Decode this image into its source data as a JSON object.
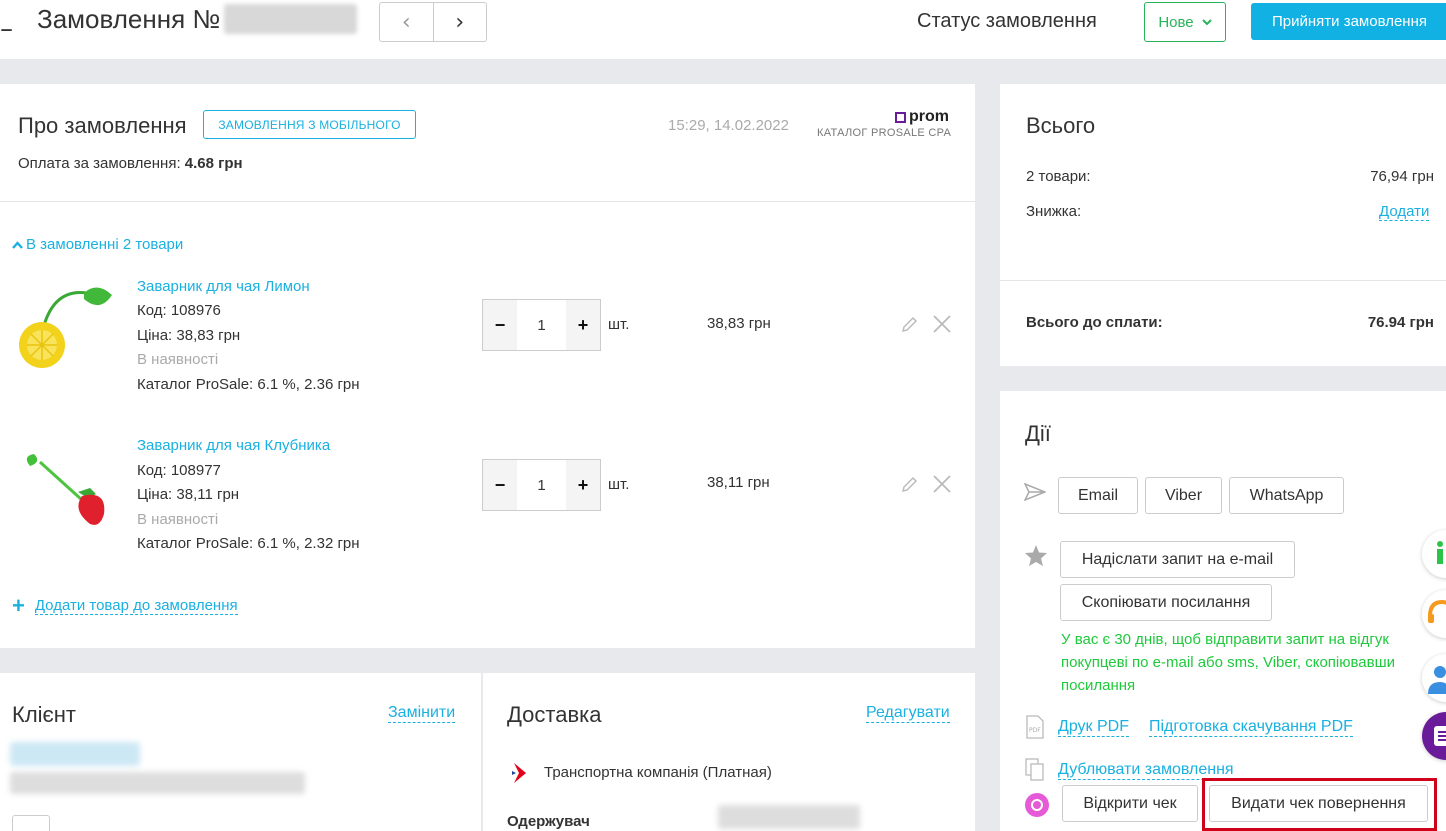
{
  "header": {
    "title": "Замовлення №",
    "status_label": "Статус замовлення",
    "status_value": "Нове",
    "accept_button": "Прийняти замовлення"
  },
  "order": {
    "title": "Про замовлення",
    "mobile_badge": "ЗАМОВЛЕННЯ З МОБІЛЬНОГО",
    "datetime": "15:29, 14.02.2022",
    "logo_text": "prom",
    "catalog_label": "КАТАЛОГ PROSALE CPA",
    "payment_label": "Оплата за замовлення:",
    "payment_value": "4.68 грн",
    "items_toggle": "В замовленні 2 товари",
    "items": [
      {
        "name": "Заварник для чая Лимон",
        "code": "Код: 108976",
        "price": "Ціна: 38,83 грн",
        "stock": "В наявності",
        "catalog": "Каталог ProSale: 6.1 %, 2.36 грн",
        "qty": "1",
        "unit": "шт.",
        "total": "38,83 грн"
      },
      {
        "name": "Заварник для чая Клубника",
        "code": "Код: 108977",
        "price": "Ціна: 38,11 грн",
        "stock": "В наявності",
        "catalog": "Каталог ProSale: 6.1 %, 2.32 грн",
        "qty": "1",
        "unit": "шт.",
        "total": "38,11 грн"
      }
    ],
    "add_product": "Додати товар до замовлення"
  },
  "totals": {
    "title": "Всього",
    "items_label": "2 товари:",
    "items_value": "76,94 грн",
    "discount_label": "Знижка:",
    "discount_link": "Додати",
    "grand_label": "Всього до сплати:",
    "grand_value": "76.94 грн"
  },
  "actions": {
    "title": "Дії",
    "email": "Email",
    "viber": "Viber",
    "whatsapp": "WhatsApp",
    "send_request": "Надіслати запит на e-mail",
    "copy_link": "Скопіювати посилання",
    "notice": "У вас є 30 днів, щоб відправити запит на відгук покупцеві по e-mail або sms, Viber, скопіювавши посилання",
    "print_pdf": "Друк PDF",
    "prepare_pdf": "Підготовка скачування PDF",
    "duplicate": "Дублювати замовлення",
    "open_receipt": "Відкрити чек",
    "refund_receipt": "Видати чек повернення"
  },
  "client": {
    "title": "Клієнт",
    "replace_link": "Замінити"
  },
  "delivery": {
    "title": "Доставка",
    "edit_link": "Редагувати",
    "method": "Транспортна компанія (Платная)",
    "recipient_label": "Одержувач"
  }
}
